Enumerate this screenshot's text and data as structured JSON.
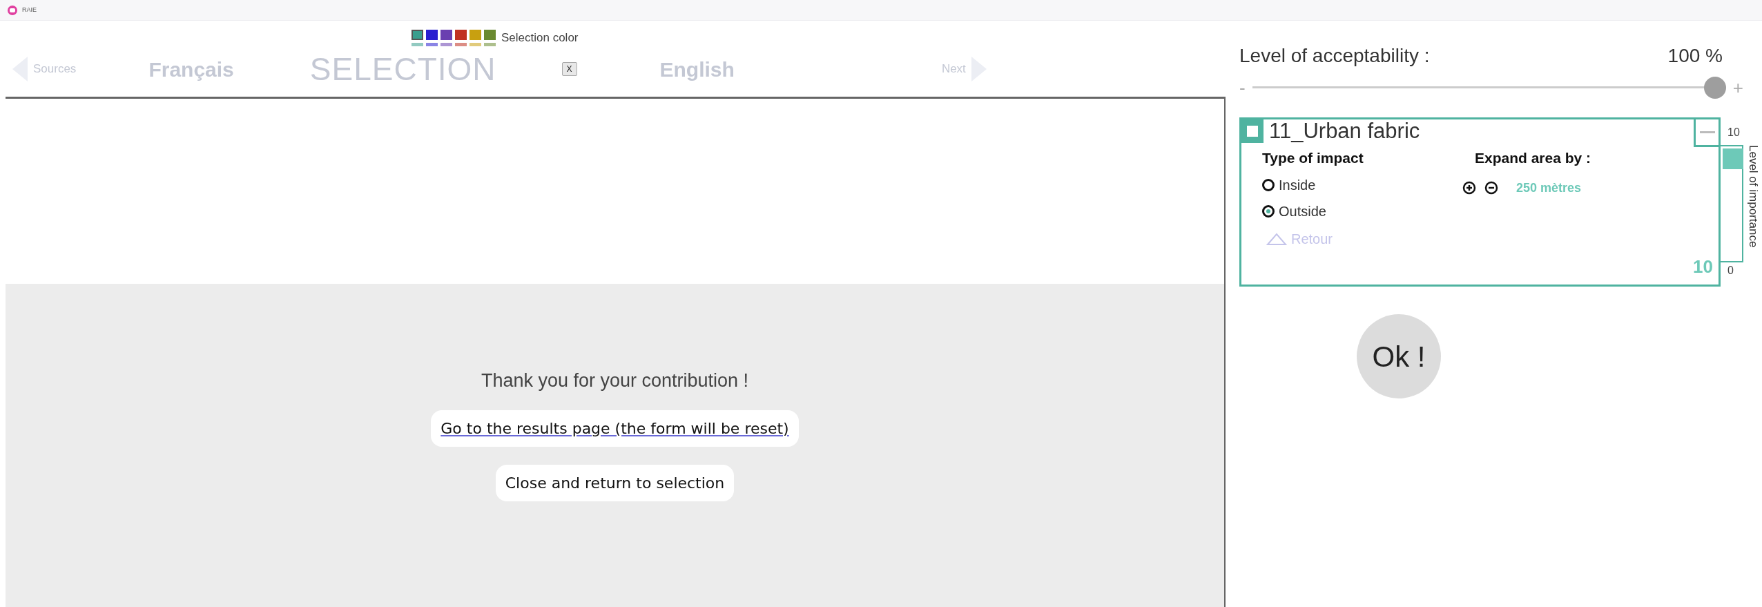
{
  "app_title": "RAIE",
  "selection_colors": {
    "label": "Selection color",
    "swatches": [
      {
        "color": "#3a9e8e",
        "selected": true
      },
      {
        "color": "#2a1fd0",
        "selected": false
      },
      {
        "color": "#6a3fb0",
        "selected": false
      },
      {
        "color": "#c03020",
        "selected": false
      },
      {
        "color": "#c8a010",
        "selected": false
      },
      {
        "color": "#6a8a30",
        "selected": false
      }
    ]
  },
  "nav": {
    "previous": "Sources",
    "source_language": "Français",
    "title": "SELECTION",
    "close": "X",
    "target_language": "English",
    "next": "Next"
  },
  "dialog": {
    "message": "Thank you for your contribution !",
    "buttons": [
      {
        "kind": "link",
        "label": "Go to the results page (the form will be reset)"
      },
      {
        "kind": "plain",
        "label": "Close and return to selection"
      }
    ]
  },
  "acceptability": {
    "label": "Level of acceptability :",
    "reading": "100 %",
    "minus": "-",
    "plus": "+",
    "level": 1
  },
  "layer": {
    "title": "11_Urban fabric",
    "impact_heading": "Type of impact",
    "impact_options": [
      {
        "label": "Inside",
        "selected": false
      },
      {
        "label": "Outside",
        "selected": true
      }
    ],
    "back": {
      "label": "Retour",
      "disabled": true
    },
    "expand_heading": "Expand area by :",
    "expand_value": "250 mètres",
    "importance_value": "10",
    "importance": {
      "label": "Level of importance",
      "max": "10",
      "min": "0"
    }
  },
  "ok_button": "Ok !"
}
